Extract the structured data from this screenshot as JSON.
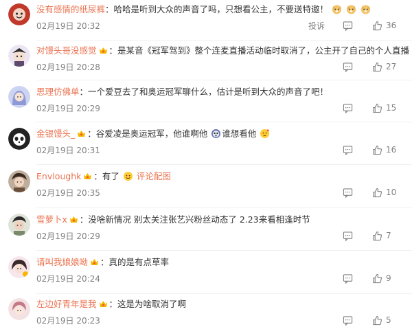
{
  "comments": [
    {
      "user": "没有感情的纸尿裤",
      "has_badge": false,
      "text": "哈哈是听到大众的声音了吗，只想看公主，不要送特邀！",
      "trailing_emoji": "doge-icon x3",
      "time": "02月19日 20:32",
      "report_label": "投诉",
      "likes": "36",
      "avatar_color": "#c0392b"
    },
    {
      "user": "对馒头哥没感觉",
      "has_badge": true,
      "text": "是某音《冠军驾到》整个连麦直播活动临时取消了，公主开了自己的个人直播",
      "time": "02月19日 20:28",
      "likes": "27",
      "avatar_color": "#5d4a6e"
    },
    {
      "user": "思理仿佛单",
      "has_badge": false,
      "text": "一个爱豆去了和奥运冠军聊什么，估计是听到大众的声音了吧！",
      "time": "02月19日 20:29",
      "likes": "15",
      "avatar_color": "#8e9ad8"
    },
    {
      "user": "金银馒头_",
      "has_badge": true,
      "text_a": "谷爱凌是奥运冠军，他谁啊他",
      "text_b": "谁想看他",
      "time": "02月19日 20:31",
      "likes": "16",
      "avatar_color": "#222222"
    },
    {
      "user": "Envloughk",
      "has_badge": true,
      "text": "有了",
      "link": "评论配图",
      "time": "02月19日 20:35",
      "likes": "10",
      "avatar_color": "#6b4f3a"
    },
    {
      "user": "雪萝卜x",
      "has_badge": true,
      "text": "没啥新情况 别太关注张艺兴粉丝动态了 2.23来看相逢时节",
      "time": "02月19日 20:29",
      "likes": "7",
      "avatar_color": "#7a8a6a"
    },
    {
      "user": "请叫我娘娘呦",
      "has_badge": true,
      "text": "真的是有点草率",
      "time": "02月19日 20:24",
      "likes": "9",
      "avatar_color": "#d98aa0"
    },
    {
      "user": "左边好青年是我",
      "has_badge": true,
      "text": "这是为啥取消了啊",
      "time": "02月19日 20:23",
      "likes": "5",
      "avatar_color": "#c47a86"
    }
  ],
  "colors": {
    "username": "#eb7350",
    "text": "#333333",
    "meta": "#808080"
  }
}
